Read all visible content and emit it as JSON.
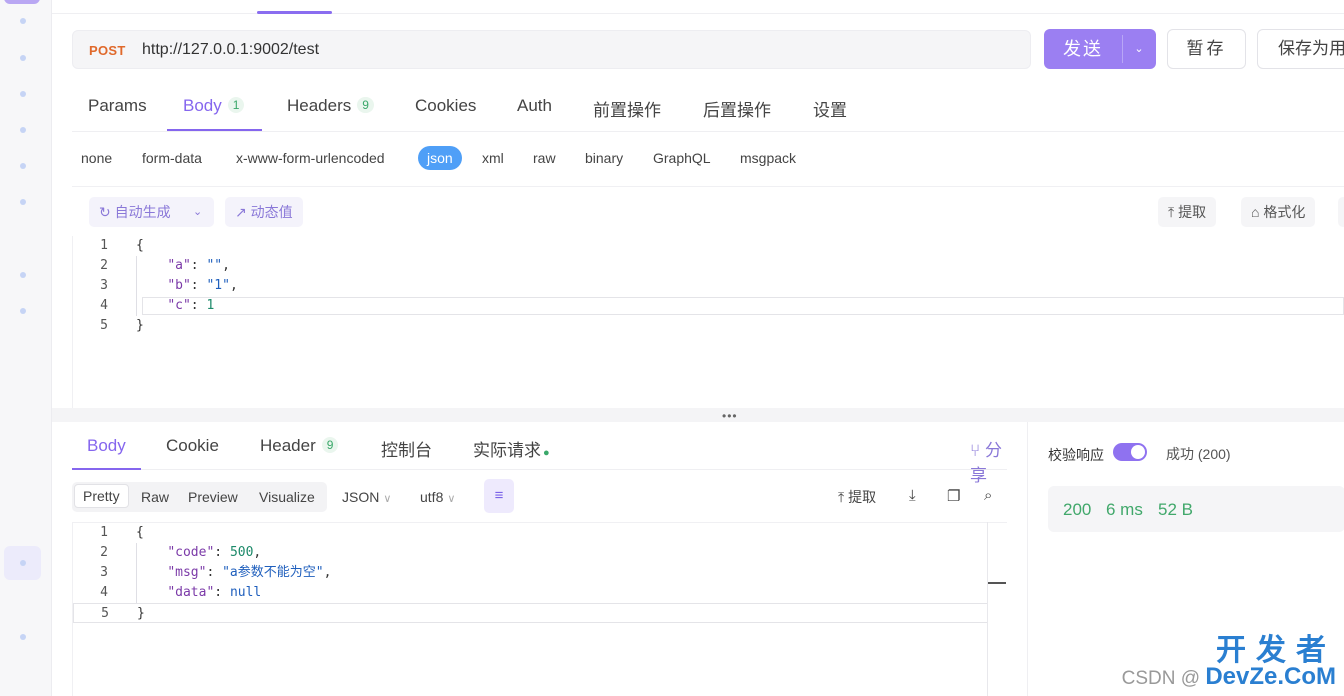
{
  "url_bar": {
    "method": "POST",
    "url": "http://127.0.0.1:9002/test"
  },
  "actions": {
    "send": "发送",
    "save_draft": "暂存",
    "save_as": "保存为用"
  },
  "request_tabs": {
    "params": "Params",
    "body": "Body",
    "body_count": "1",
    "headers": "Headers",
    "headers_count": "9",
    "cookies": "Cookies",
    "auth": "Auth",
    "pre_ops": "前置操作",
    "post_ops": "后置操作",
    "settings": "设置"
  },
  "body_types": [
    "none",
    "form-data",
    "x-www-form-urlencoded",
    "json",
    "xml",
    "raw",
    "binary",
    "GraphQL",
    "msgpack"
  ],
  "body_types_active": "json",
  "editor_toolbar": {
    "auto_generate": "自动生成",
    "dynamic_value": "动态值",
    "extract": "提取",
    "format": "格式化"
  },
  "request_body": {
    "lines": [
      "1",
      "2",
      "3",
      "4",
      "5"
    ],
    "open": "{",
    "close": "}",
    "a_key": "\"a\"",
    "a_val": "\"\"",
    "b_key": "\"b\"",
    "b_val": "\"1\"",
    "c_key": "\"c\"",
    "c_val": "1"
  },
  "response_tabs": {
    "body": "Body",
    "cookie": "Cookie",
    "header": "Header",
    "header_count": "9",
    "console": "控制台",
    "actual_request": "实际请求",
    "share": "分享"
  },
  "response_toolbar": {
    "pretty": "Pretty",
    "raw": "Raw",
    "preview": "Preview",
    "visualize": "Visualize",
    "format": "JSON",
    "encoding": "utf8",
    "extract": "提取"
  },
  "response_body": {
    "code_key": "\"code\"",
    "code_val": "500",
    "msg_key": "\"msg\"",
    "msg_val": "\"a参数不能为空\"",
    "data_key": "\"data\"",
    "data_val": "null"
  },
  "right_panel": {
    "validate_label": "校验响应",
    "status": "成功 (200)",
    "code": "200",
    "time": "6 ms",
    "size": "52 B"
  },
  "watermark": {
    "brand": "开发者",
    "csdn": "CSDN @",
    "site": "DevZe.CoM"
  },
  "colors": {
    "accent": "#8566ee",
    "method": "#e0692b",
    "success": "#41a86b",
    "json_chip": "#4f9ff7"
  }
}
